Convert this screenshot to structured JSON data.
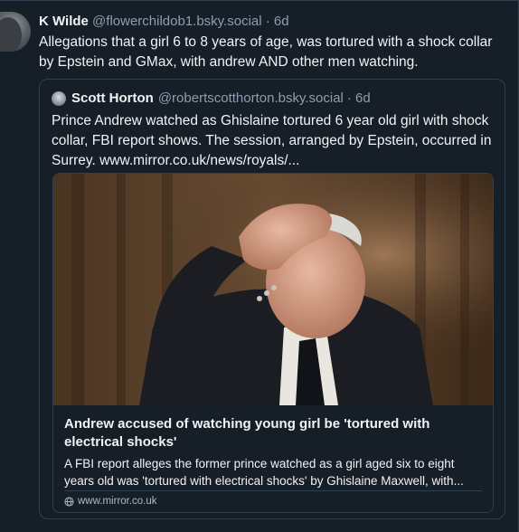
{
  "post": {
    "author_name": "K Wilde",
    "author_handle": "@flowerchildob1.bsky.social",
    "time": "· 6d",
    "text": "Allegations that a girl 6 to 8 years of age, was tortured with a shock collar by Epstein and GMax, with andrew AND other men watching."
  },
  "quote": {
    "author_name": "Scott Horton",
    "author_handle": "@robertscotthorton.bsky.social",
    "time": "· 6d",
    "text": "Prince Andrew watched as Ghislaine tortured 6 year old girl with shock collar, FBI report shows. The session, arranged by Epstein, occurred in Surrey. www.mirror.co.uk/news/royals/..."
  },
  "link_card": {
    "title": "Andrew accused of watching young girl be 'tortured with electrical shocks'",
    "description": "A FBI report alleges the former prince watched as a girl aged six to eight years old was 'tortured with electrical shocks' by Ghislaine Maxwell, with...",
    "source": "www.mirror.co.uk",
    "source_icon": "globe-icon"
  },
  "colors": {
    "background": "#161e27",
    "border": "#2e4052",
    "text": "#f1f3f5",
    "muted": "#8d9eb0"
  }
}
